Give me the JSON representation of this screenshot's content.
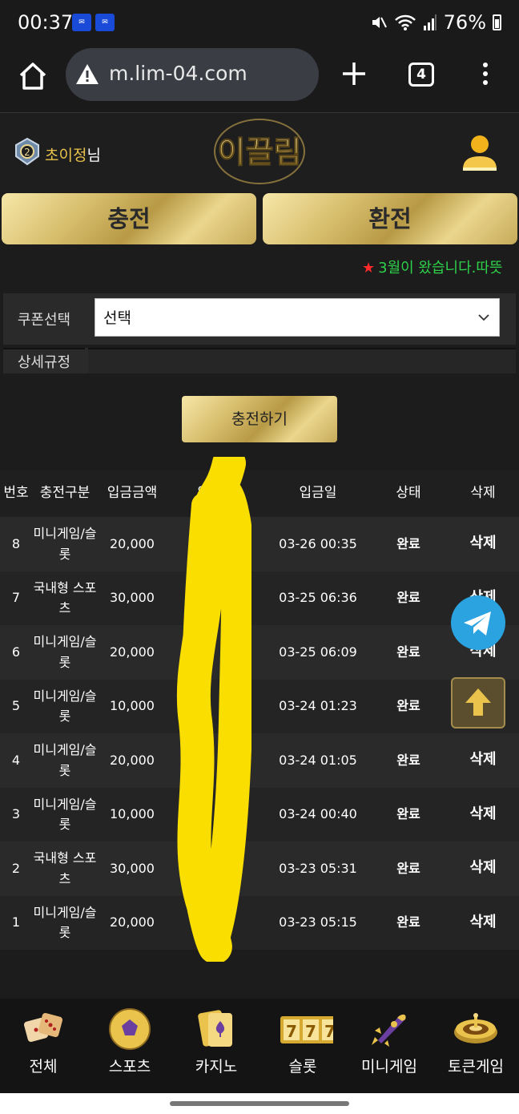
{
  "status_bar": {
    "time": "00:37",
    "battery": "76%",
    "notif_icons": [
      "app-notification-icon",
      "app-notification-icon"
    ]
  },
  "browser": {
    "url": "m.lim-04.com",
    "tab_count": "4"
  },
  "header": {
    "nickname": "초이정",
    "suffix": "님",
    "logo_text": "이끌림"
  },
  "actions": {
    "charge": "충전",
    "exchange": "환전"
  },
  "marquee": {
    "star": "★",
    "text": "3월이 왔습니다.따뜻"
  },
  "form": {
    "coupon_label": "쿠폰선택",
    "coupon_value": "선택",
    "detail_label": "상세규정",
    "submit": "충전하기"
  },
  "table": {
    "headers": [
      "번호",
      "충전구분",
      "입금금액",
      "입금자",
      "입금일",
      "상태",
      "삭제"
    ],
    "rows": [
      {
        "no": "8",
        "type": "미니게임/슬롯",
        "amount": "20,000",
        "depositor": "",
        "date": "03-26 00:35",
        "state": "완료",
        "del": "삭제"
      },
      {
        "no": "7",
        "type": "국내형 스포츠",
        "amount": "30,000",
        "depositor": "",
        "date": "03-25 06:36",
        "state": "완료",
        "del": "삭제"
      },
      {
        "no": "6",
        "type": "미니게임/슬롯",
        "amount": "20,000",
        "depositor": "",
        "date": "03-25 06:09",
        "state": "완료",
        "del": "삭제"
      },
      {
        "no": "5",
        "type": "미니게임/슬롯",
        "amount": "10,000",
        "depositor": "",
        "date": "03-24 01:23",
        "state": "완료",
        "del": "삭제"
      },
      {
        "no": "4",
        "type": "미니게임/슬롯",
        "amount": "20,000",
        "depositor": "",
        "date": "03-24 01:05",
        "state": "완료",
        "del": "삭제"
      },
      {
        "no": "3",
        "type": "미니게임/슬롯",
        "amount": "10,000",
        "depositor": "",
        "date": "03-24 00:40",
        "state": "완료",
        "del": "삭제"
      },
      {
        "no": "2",
        "type": "국내형 스포츠",
        "amount": "30,000",
        "depositor": "",
        "date": "03-23 05:31",
        "state": "완료",
        "del": "삭제"
      },
      {
        "no": "1",
        "type": "미니게임/슬롯",
        "amount": "20,000",
        "depositor": "",
        "date": "03-23 05:15",
        "state": "완료",
        "del": "삭제"
      }
    ]
  },
  "bottom_nav": [
    {
      "label": "전체",
      "icon": "dice-icon"
    },
    {
      "label": "스포츠",
      "icon": "soccer-ball-icon"
    },
    {
      "label": "카지노",
      "icon": "playing-cards-icon"
    },
    {
      "label": "슬롯",
      "icon": "slot-777-icon"
    },
    {
      "label": "미니게임",
      "icon": "rocket-icon"
    },
    {
      "label": "토큰게임",
      "icon": "roulette-icon"
    }
  ],
  "colors": {
    "gold": "#d9c070",
    "marquee_green": "#2ed14a",
    "star_red": "#ff2a2a",
    "nickname_gold": "#e9c34b",
    "telegram_blue": "#2aa3e0"
  }
}
